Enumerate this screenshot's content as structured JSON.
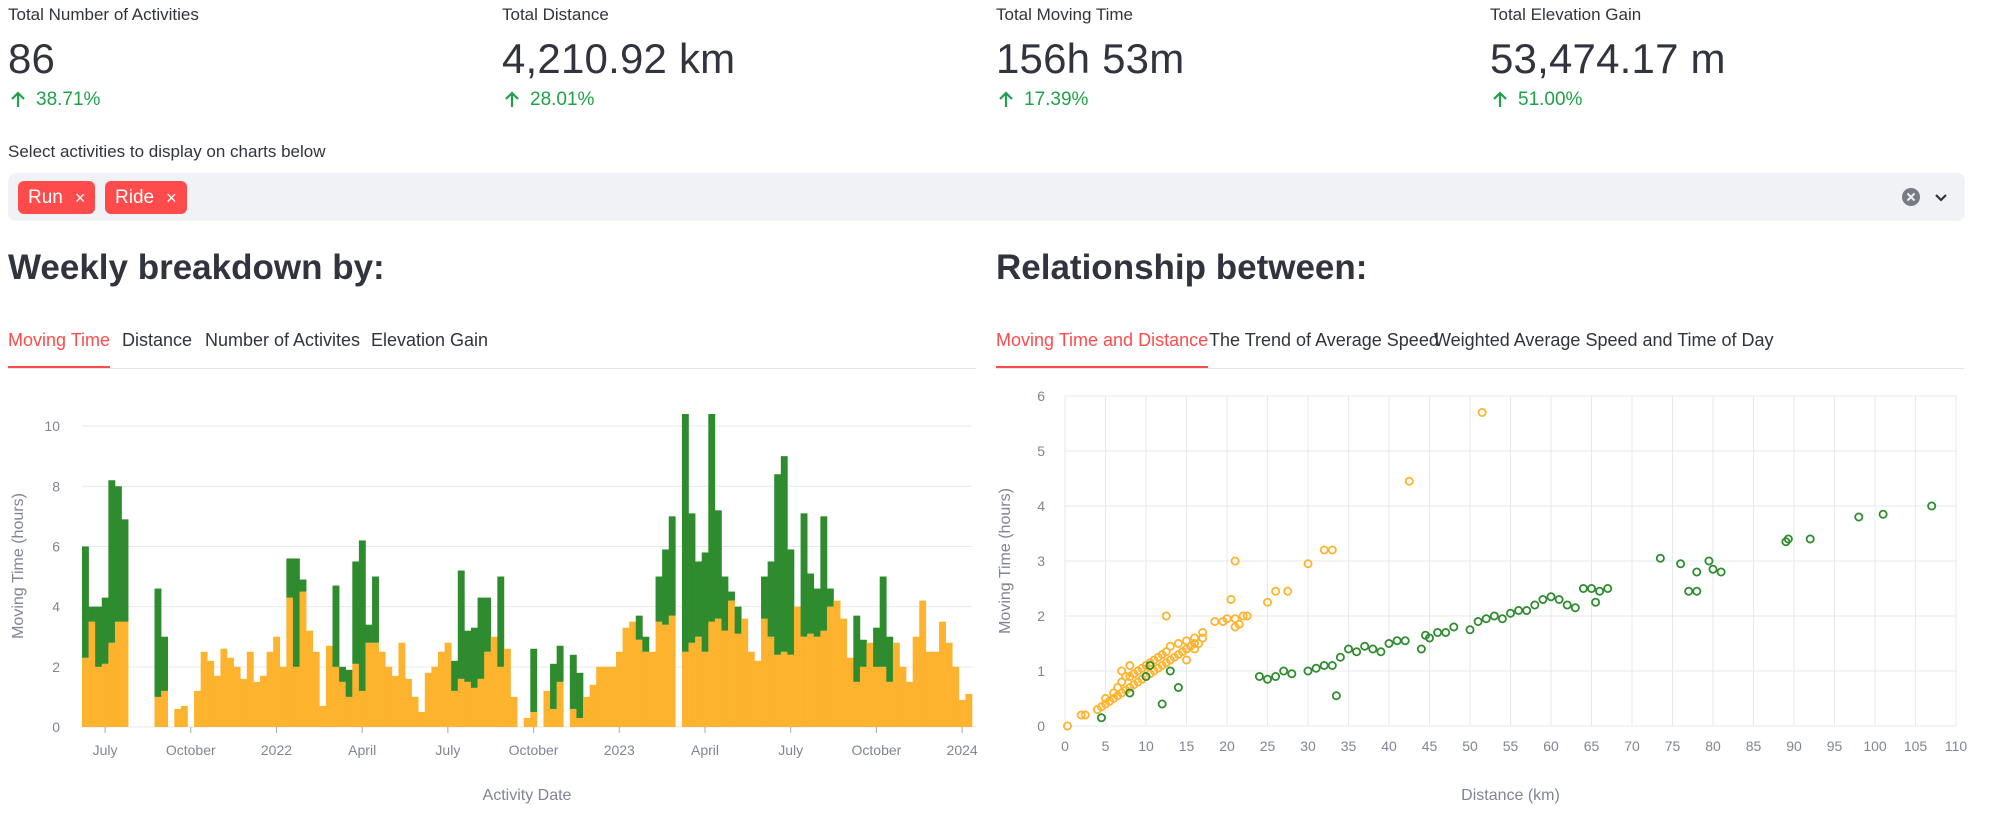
{
  "metrics": [
    {
      "label": "Total Number of Activities",
      "value": "86",
      "delta": "38.71%"
    },
    {
      "label": "Total Distance",
      "value": "4,210.92 km",
      "delta": "28.01%"
    },
    {
      "label": "Total Moving Time",
      "value": "156h 53m",
      "delta": "17.39%"
    },
    {
      "label": "Total Elevation Gain",
      "value": "53,474.17 m",
      "delta": "51.00%"
    }
  ],
  "activity_select": {
    "label": "Select activities to display on charts below",
    "tags": [
      "Run",
      "Ride"
    ],
    "remove_glyph": "×"
  },
  "weekly": {
    "heading": "Weekly breakdown by:",
    "tabs": [
      "Moving Time",
      "Distance",
      "Number of Activites",
      "Elevation Gain"
    ],
    "active_tab": 0
  },
  "relationship": {
    "heading": "Relationship between:",
    "tabs": [
      "Moving Time and Distance",
      "The Trend of Average Speed",
      "Weighted Average Speed and Time of Day"
    ],
    "active_tab": 0
  },
  "colors": {
    "run": "#fdb32e",
    "ride": "#2e8b2e",
    "accent": "#ff4b4b",
    "delta_up": "#21a04a"
  },
  "chart_data": [
    {
      "type": "bar",
      "stacked": true,
      "xlabel": "Activity Date",
      "ylabel": "Moving Time (hours)",
      "ylim": [
        0,
        10.7
      ],
      "yticks": [
        0,
        2,
        4,
        6,
        8,
        10
      ],
      "xticks": [
        {
          "label": "July",
          "index": 3
        },
        {
          "label": "October",
          "index": 16
        },
        {
          "label": "2022",
          "index": 29
        },
        {
          "label": "April",
          "index": 42
        },
        {
          "label": "July",
          "index": 55
        },
        {
          "label": "October",
          "index": 68
        },
        {
          "label": "2023",
          "index": 81
        },
        {
          "label": "April",
          "index": 94
        },
        {
          "label": "July",
          "index": 107
        },
        {
          "label": "October",
          "index": 120
        },
        {
          "label": "2024",
          "index": 133
        }
      ],
      "grid": true,
      "series": [
        {
          "name": "Run",
          "values": [
            2.3,
            3.5,
            2.0,
            2.1,
            2.8,
            3.5,
            3.5,
            0,
            0,
            0,
            0,
            1.0,
            1.2,
            0,
            0.6,
            0.7,
            0,
            1.2,
            2.5,
            2.2,
            1.7,
            2.6,
            2.3,
            2.0,
            1.6,
            2.5,
            1.5,
            1.7,
            2.5,
            3.0,
            2.0,
            4.3,
            2.0,
            4.5,
            3.2,
            2.5,
            0.7,
            2.7,
            2.0,
            1.5,
            1.0,
            2.1,
            1.2,
            2.8,
            2.8,
            2.5,
            2.0,
            1.7,
            2.8,
            1.6,
            1.0,
            0.5,
            1.8,
            2.0,
            2.5,
            2.8,
            1.2,
            1.6,
            1.5,
            1.3,
            1.6,
            2.5,
            3.0,
            2.0,
            2.6,
            1.0,
            0,
            0.3,
            0.5,
            0,
            1.2,
            0.6,
            1.5,
            0,
            0.6,
            0.3,
            1.0,
            1.4,
            2.0,
            2.0,
            2.0,
            2.5,
            3.3,
            3.5,
            2.9,
            2.5,
            2.5,
            3.5,
            3.4,
            3.7,
            0,
            2.5,
            2.8,
            3.0,
            2.5,
            3.5,
            3.6,
            3.2,
            4.2,
            3.1,
            3.6,
            2.5,
            2.2,
            3.6,
            3.0,
            2.4,
            2.5,
            2.4,
            4.0,
            3.0,
            3.1,
            3.0,
            3.2,
            4.0,
            4.2,
            3.6,
            2.3,
            1.5,
            2.0,
            2.8,
            2.0,
            2.0,
            1.5,
            2.8,
            2.0,
            1.5,
            3.0,
            4.2,
            2.5,
            2.5,
            3.5,
            2.8,
            2.0,
            0.9,
            1.1
          ]
        },
        {
          "name": "Ride",
          "values": [
            3.7,
            0.5,
            2.0,
            2.2,
            5.4,
            4.5,
            3.4,
            0,
            0,
            0,
            0,
            3.6,
            1.8,
            0,
            0,
            0,
            0,
            0,
            0,
            0,
            0,
            0,
            0,
            0,
            0,
            0,
            0,
            0,
            0,
            0,
            0,
            1.3,
            3.6,
            0.4,
            0,
            0,
            0,
            0,
            2.7,
            0.5,
            0.9,
            3.4,
            5.0,
            0.6,
            2.2,
            0,
            0,
            0,
            0,
            0,
            0,
            0,
            0,
            0,
            0,
            0,
            1.0,
            3.6,
            1.7,
            2.0,
            2.7,
            1.8,
            0,
            3.0,
            0,
            0,
            0,
            0,
            2.1,
            0,
            0,
            1.5,
            1.2,
            0,
            1.8,
            1.5,
            0,
            0,
            0,
            0,
            0,
            0,
            0,
            0,
            0.8,
            0.5,
            0,
            1.5,
            2.5,
            3.3,
            0,
            7.9,
            4.3,
            2.5,
            3.3,
            6.9,
            3.6,
            1.8,
            0.3,
            0.9,
            0,
            0,
            0,
            1.4,
            2.5,
            6.0,
            6.5,
            3.5,
            0,
            4.1,
            2.0,
            1.6,
            3.8,
            0.6,
            0,
            0,
            0,
            2.2,
            0.9,
            0,
            1.3,
            3.0,
            1.5,
            0,
            0,
            0,
            0,
            0,
            0,
            0,
            0,
            0,
            0,
            0,
            0
          ]
        }
      ]
    },
    {
      "type": "scatter",
      "xlabel": "Distance (km)",
      "ylabel": "Moving Time (hours)",
      "xlim": [
        0,
        110
      ],
      "ylim": [
        0,
        6
      ],
      "xticks": [
        0,
        5,
        10,
        15,
        20,
        25,
        30,
        35,
        40,
        45,
        50,
        55,
        60,
        65,
        70,
        75,
        80,
        85,
        90,
        95,
        100,
        105,
        110
      ],
      "yticks": [
        0,
        1,
        2,
        3,
        4,
        5,
        6
      ],
      "grid": true,
      "series": [
        {
          "name": "Run",
          "points": [
            [
              0.3,
              0.0
            ],
            [
              2,
              0.2
            ],
            [
              2.5,
              0.2
            ],
            [
              4,
              0.3
            ],
            [
              4.5,
              0.35
            ],
            [
              5,
              0.4
            ],
            [
              5.5,
              0.45
            ],
            [
              6,
              0.5
            ],
            [
              6.5,
              0.55
            ],
            [
              7,
              0.6
            ],
            [
              7.5,
              0.65
            ],
            [
              8,
              0.7
            ],
            [
              8.5,
              0.75
            ],
            [
              9,
              0.8
            ],
            [
              9.5,
              0.85
            ],
            [
              10,
              0.9
            ],
            [
              10.5,
              0.95
            ],
            [
              11,
              1.0
            ],
            [
              11.5,
              1.05
            ],
            [
              12,
              1.1
            ],
            [
              12.5,
              1.15
            ],
            [
              13,
              1.2
            ],
            [
              13.5,
              1.25
            ],
            [
              14,
              1.3
            ],
            [
              14.5,
              1.35
            ],
            [
              15,
              1.4
            ],
            [
              15.5,
              1.45
            ],
            [
              16,
              1.5
            ],
            [
              16.5,
              1.5
            ],
            [
              5,
              0.5
            ],
            [
              6,
              0.6
            ],
            [
              7,
              0.8
            ],
            [
              8,
              0.9
            ],
            [
              9,
              1.0
            ],
            [
              10,
              1.1
            ],
            [
              11,
              1.2
            ],
            [
              12,
              1.3
            ],
            [
              6.5,
              0.7
            ],
            [
              7.5,
              0.9
            ],
            [
              8.5,
              0.95
            ],
            [
              9.5,
              1.05
            ],
            [
              10.5,
              1.15
            ],
            [
              11.5,
              1.25
            ],
            [
              12.5,
              1.35
            ],
            [
              13,
              1.45
            ],
            [
              14,
              1.5
            ],
            [
              15,
              1.55
            ],
            [
              16,
              1.6
            ],
            [
              17,
              1.6
            ],
            [
              7,
              1.0
            ],
            [
              8,
              1.1
            ],
            [
              12.5,
              2.0
            ],
            [
              15,
              1.2
            ],
            [
              16,
              1.4
            ],
            [
              17,
              1.7
            ],
            [
              18.5,
              1.9
            ],
            [
              19.5,
              1.9
            ],
            [
              20,
              1.95
            ],
            [
              20.5,
              2.3
            ],
            [
              21,
              1.8
            ],
            [
              21,
              1.95
            ],
            [
              21.5,
              1.85
            ],
            [
              21,
              3.0
            ],
            [
              22,
              2.0
            ],
            [
              22.5,
              2.0
            ],
            [
              25,
              2.25
            ],
            [
              26,
              2.45
            ],
            [
              27.5,
              2.45
            ],
            [
              30,
              2.95
            ],
            [
              32,
              3.2
            ],
            [
              33,
              3.2
            ],
            [
              42.5,
              4.45
            ],
            [
              51.5,
              5.7
            ]
          ]
        },
        {
          "name": "Ride",
          "points": [
            [
              4.5,
              0.15
            ],
            [
              8,
              0.6
            ],
            [
              10,
              0.9
            ],
            [
              10.5,
              1.1
            ],
            [
              12,
              0.4
            ],
            [
              13,
              1.0
            ],
            [
              14,
              0.7
            ],
            [
              24,
              0.9
            ],
            [
              25,
              0.85
            ],
            [
              26,
              0.9
            ],
            [
              27,
              1.0
            ],
            [
              28,
              0.95
            ],
            [
              30,
              1.0
            ],
            [
              31,
              1.05
            ],
            [
              32,
              1.1
            ],
            [
              33,
              1.1
            ],
            [
              33.5,
              0.55
            ],
            [
              34,
              1.25
            ],
            [
              35,
              1.4
            ],
            [
              36,
              1.35
            ],
            [
              37,
              1.45
            ],
            [
              38,
              1.4
            ],
            [
              39,
              1.35
            ],
            [
              40,
              1.5
            ],
            [
              41,
              1.55
            ],
            [
              42,
              1.55
            ],
            [
              44,
              1.4
            ],
            [
              44.5,
              1.65
            ],
            [
              45,
              1.6
            ],
            [
              46,
              1.7
            ],
            [
              47,
              1.7
            ],
            [
              48,
              1.8
            ],
            [
              50,
              1.75
            ],
            [
              51,
              1.9
            ],
            [
              52,
              1.95
            ],
            [
              53,
              2.0
            ],
            [
              54,
              1.95
            ],
            [
              55,
              2.05
            ],
            [
              56,
              2.1
            ],
            [
              57,
              2.1
            ],
            [
              58,
              2.2
            ],
            [
              59,
              2.3
            ],
            [
              60,
              2.35
            ],
            [
              61,
              2.3
            ],
            [
              62,
              2.2
            ],
            [
              63,
              2.15
            ],
            [
              64,
              2.5
            ],
            [
              65,
              2.5
            ],
            [
              65.5,
              2.25
            ],
            [
              66,
              2.45
            ],
            [
              67,
              2.5
            ],
            [
              73.5,
              3.05
            ],
            [
              76,
              2.95
            ],
            [
              77,
              2.45
            ],
            [
              78,
              2.45
            ],
            [
              78,
              2.8
            ],
            [
              79.5,
              3.0
            ],
            [
              80,
              2.85
            ],
            [
              81,
              2.8
            ],
            [
              89,
              3.35
            ],
            [
              89.3,
              3.4
            ],
            [
              92,
              3.4
            ],
            [
              98,
              3.8
            ],
            [
              101,
              3.85
            ],
            [
              107,
              4.0
            ]
          ]
        }
      ]
    }
  ]
}
